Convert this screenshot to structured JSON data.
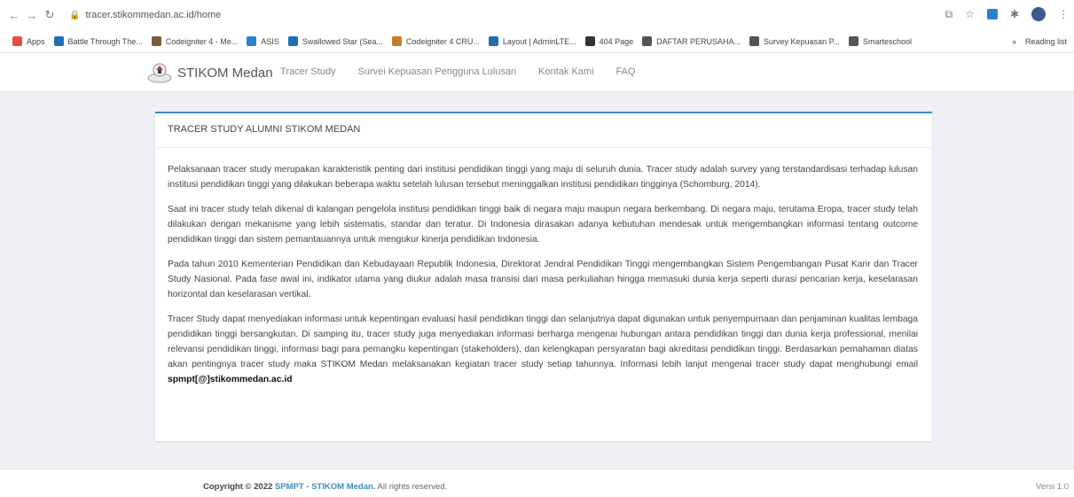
{
  "browser": {
    "url": "tracer.stikommedan.ac.id/home",
    "bookmarks": [
      {
        "label": "Apps",
        "color": "#e84c3d"
      },
      {
        "label": "Battle Through The...",
        "color": "#1e6fb9"
      },
      {
        "label": "Codeigniter 4 - Me...",
        "color": "#7a5c3e"
      },
      {
        "label": "ASIS",
        "color": "#2a7fd4"
      },
      {
        "label": "Swallowed Star (Sea...",
        "color": "#1e6fb9"
      },
      {
        "label": "Codeigniter 4 CRU...",
        "color": "#c47e2a"
      },
      {
        "label": "Layout | AdminLTE...",
        "color": "#2a6bb6"
      },
      {
        "label": "404 Page",
        "color": "#333333"
      },
      {
        "label": "DAFTAR PERUSAHA...",
        "color": "#555555"
      },
      {
        "label": "Survey Kepuasan P...",
        "color": "#555555"
      },
      {
        "label": "Smarteschool",
        "color": "#555555"
      }
    ],
    "more_label": "»",
    "reading_list": "Reading list"
  },
  "nav": {
    "brand": "STIKOM Medan",
    "menu": [
      "Tracer Study",
      "Survei Kepuasan Pengguna Lulusan",
      "Kontak Kami",
      "FAQ"
    ]
  },
  "card": {
    "title": "TRACER STUDY ALUMNI STIKOM MEDAN",
    "paragraphs": [
      "Pelaksanaan tracer study merupakan karakteristik penting dari institusi pendidikan tinggi yang maju di seluruh dunia. Tracer study adalah survey yang terstandardisasi terhadap lulusan institusi pendidikan tinggi yang dilakukan beberapa waktu setelah lulusan tersebut meninggalkan institusi pendidikan tingginya (Schomburg, 2014).",
      "Saat ini tracer study telah dikenal di kalangan pengelola institusi pendidikan tinggi baik di negara maju maupun negara berkembang. Di negara maju, terutama Eropa, tracer study telah dilakukan dengan mekanisme yang lebih sistematis, standar dan teratur. Di Indonesia dirasakan adanya kebutuhan mendesak untuk mengembangkan informasi tentang outcome pendidikan tinggi dan sistem pemantauannya untuk mengukur kinerja pendidikan Indonesia.",
      "Pada tahun 2010 Kementerian Pendidikan dan Kebudayaan Republik Indonesia, Direktorat Jendral Pendidikan Tinggi mengembangkan Sistem Pengembangan Pusat Karir dan Tracer Study Nasional. Pada fase awal ini, indikator utama yang diukur adalah masa transisi dari masa perkuliahan hingga memasuki dunia kerja seperti durasi pencarian kerja, keselarasan horizontal dan keselarasan vertikal."
    ],
    "last_paragraph": "Tracer Study dapat menyediakan informasi untuk kepentingan evaluasi hasil pendidikan tinggi dan selanjutnya dapat digunakan untuk penyempurnaan dan penjaminan kualitas lembaga pendidikan tinggi bersangkutan. Di samping itu, tracer study juga menyediakan informasi berharga mengenai hubungan antara pendidikan tinggi dan dunia kerja professional, menilai relevansi pendidikan tinggi, informasi bagi para pemangku kepentingan (stakeholders), dan kelengkapan persyaratan bagi akreditasi pendidikan tinggi. Berdasarkan pemahaman diatas akan pentingnya tracer study maka STIKOM Medan melaksanakan kegiatan tracer study setiap tahunnya. Informasi lebih lanjut mengenai tracer study dapat menghubungi email",
    "email": "spmpt[@]stikommedan.ac.id"
  },
  "footer": {
    "copyright_prefix": "Copyright © 2022",
    "org1": "SPMPT",
    "sep": " - ",
    "org2": "STIKOM Medan.",
    "suffix": "All rights reserved.",
    "version": "Versi 1.0"
  },
  "colors": {
    "accent": "#3c8dbc",
    "background": "#eef0f4"
  }
}
